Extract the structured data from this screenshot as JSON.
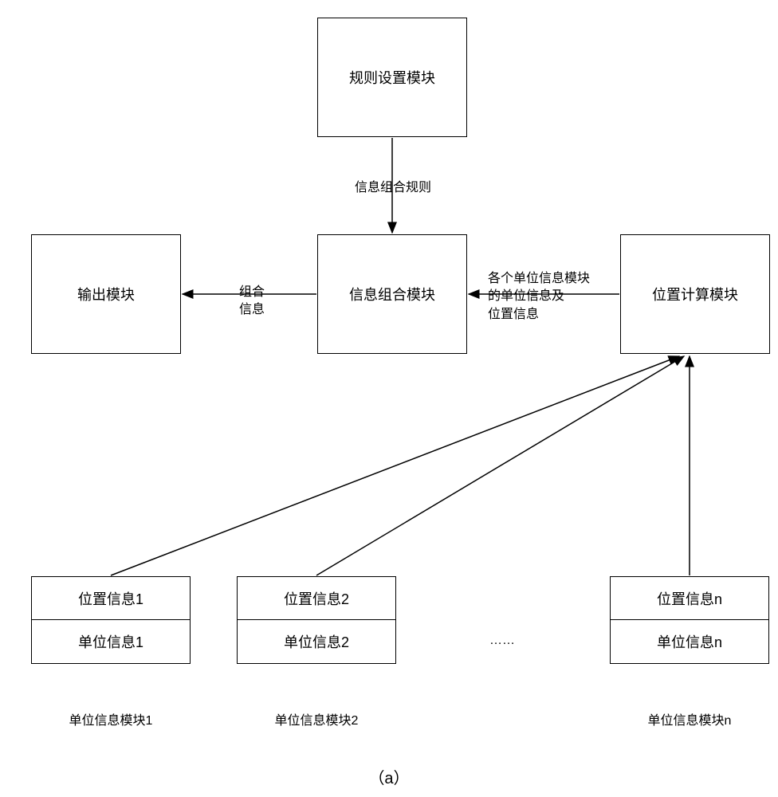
{
  "boxes": {
    "rule_setting": "规则设置模块",
    "info_combination": "信息组合模块",
    "output": "输出模块",
    "position_calc": "位置计算模块"
  },
  "edge_labels": {
    "rule_to_combo": "信息组合规则",
    "calc_to_combo_line1": "各个单位信息模块",
    "calc_to_combo_line2": "的单位信息及",
    "calc_to_combo_line3": "位置信息",
    "combo_to_output_line1": "组合",
    "combo_to_output_line2": "信息"
  },
  "units": [
    {
      "pos_label": "位置信息1",
      "unit_label": "单位信息1",
      "caption": "单位信息模块1"
    },
    {
      "pos_label": "位置信息2",
      "unit_label": "单位信息2",
      "caption": "单位信息模块2"
    },
    {
      "pos_label": "位置信息n",
      "unit_label": "单位信息n",
      "caption": "单位信息模块n"
    }
  ],
  "ellipsis": "……",
  "figure_caption": "（a）"
}
